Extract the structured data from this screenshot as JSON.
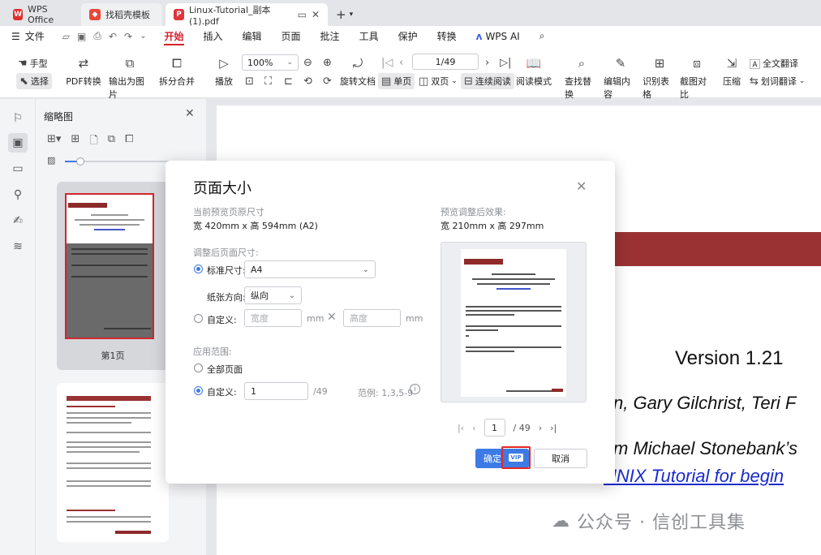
{
  "tabs": [
    {
      "label": "WPS Office"
    },
    {
      "label": "找稻壳模板"
    },
    {
      "label": "Linux-Tutorial_副本(1).pdf"
    }
  ],
  "menu": [
    "文件",
    "开始",
    "插入",
    "编辑",
    "页面",
    "批注",
    "工具",
    "保护",
    "转换",
    "WPS AI"
  ],
  "toolbar": {
    "hand": "手型",
    "select": "选择",
    "pdf_convert": "PDF转换",
    "export_image": "输出为图片",
    "split_merge": "拆分合并",
    "play": "播放",
    "zoom": "100%",
    "page_indicator": "1/49",
    "rotate": "旋转文档",
    "single": "单页",
    "double": "双页",
    "continuous": "连续阅读",
    "read_mode": "阅读模式",
    "find_replace": "查找替换",
    "edit_content": "编辑内容",
    "recognize_table": "识别表格",
    "screenshot_compare": "截图对比",
    "compress": "压缩",
    "full_translate": "全文翻译",
    "word_translate": "划词翻译"
  },
  "thumbnails": {
    "title": "缩略图",
    "page1_label": "第1页"
  },
  "document": {
    "version": "Version 1.21",
    "authors": "n, Gary Gilchrist, Teri F",
    "from": "m Michael Stonebank’s",
    "link": "UNIX Tutorial for begin",
    "watermark": "公众号 · 信创工具集"
  },
  "dialog": {
    "title": "页面大小",
    "current_label": "当前预览页原尺寸",
    "current_size": "宽 420mm x 高 594mm (A2)",
    "preview_label": "预览调整后效果:",
    "preview_size": "宽 210mm x 高 297mm",
    "adjusted_label": "调整后页面尺寸:",
    "standard_label": "标准尺寸:",
    "standard_value": "A4",
    "orientation_label": "纸张方向:",
    "orientation_value": "纵向",
    "custom_label": "自定义:",
    "width_placeholder": "宽度",
    "height_placeholder": "高度",
    "unit": "mm",
    "apply_label": "应用范围:",
    "all_pages": "全部页面",
    "custom_range_label": "自定义:",
    "custom_range_value": "1",
    "range_total": "/49",
    "range_example": "范例: 1,3,5-9",
    "pager_page": "1",
    "pager_total": "/ 49",
    "ok": "确定",
    "vip": "VIP",
    "cancel": "取消"
  },
  "colors": {
    "accent": "#d6202d",
    "primary": "#3c7be6",
    "doc_band": "#9a3233",
    "link": "#1a2acc"
  }
}
